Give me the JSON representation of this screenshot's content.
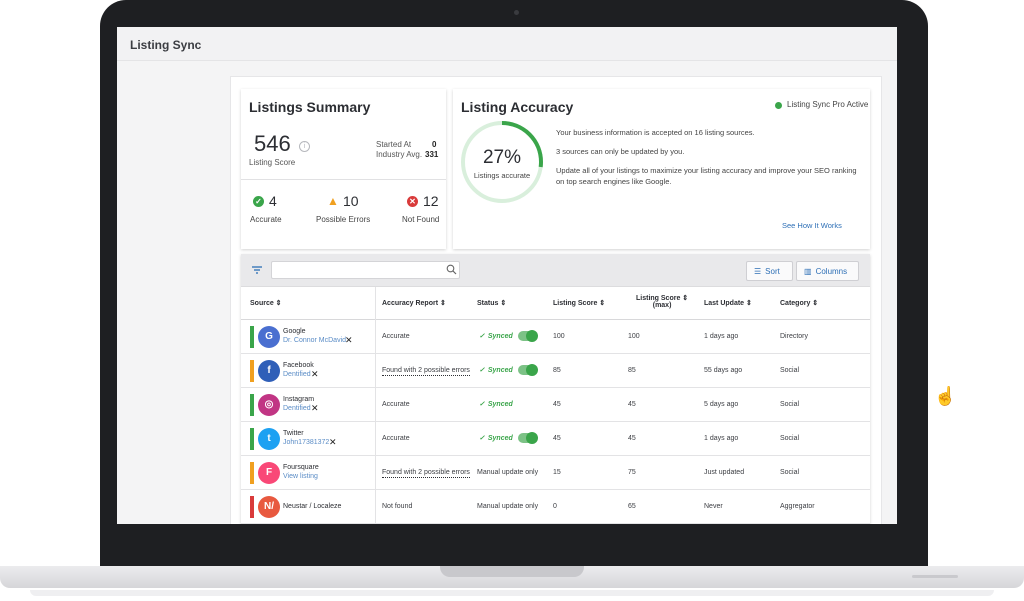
{
  "app": {
    "title": "Listing Sync"
  },
  "summary": {
    "title": "Listings Summary",
    "score": "546",
    "score_label": "Listing Score",
    "started_label": "Started At",
    "started_value": "0",
    "industry_label": "Industry Avg.",
    "industry_value": "331",
    "stats": [
      {
        "value": "4",
        "label": "Accurate",
        "icon": "check-circle-icon",
        "color": "#3aa54a"
      },
      {
        "value": "10",
        "label": "Possible Errors",
        "icon": "warning-triangle-icon",
        "color": "#f0a020"
      },
      {
        "value": "12",
        "label": "Not Found",
        "icon": "x-circle-icon",
        "color": "#d93b3b"
      }
    ]
  },
  "accuracy": {
    "title": "Listing Accuracy",
    "pro_status": "Listing Sync Pro Active",
    "percent": "27%",
    "percent_value": 27,
    "gauge_label": "Listings accurate",
    "line1": "Your business information is accepted on 16 listing sources.",
    "line2": "3 sources can only be updated by you.",
    "line3": "Update all of your listings to maximize your listing accuracy and improve your SEO ranking on top search engines like Google.",
    "see_how": "See How It Works",
    "accent": "#3aa54a"
  },
  "toolbar": {
    "search_placeholder": "",
    "sort_label": "Sort",
    "columns_label": "Columns"
  },
  "table": {
    "headers": {
      "source": "Source",
      "accuracy": "Accuracy Report",
      "status": "Status",
      "score": "Listing Score",
      "score_max_1": "Listing Score",
      "score_max_2": "(max)",
      "last_update": "Last Update",
      "category": "Category"
    },
    "rows": [
      {
        "name": "Google",
        "sub": "Dr. Connor McDavid",
        "accuracy": "Accurate",
        "status": "Synced",
        "score": "100",
        "max": "100",
        "last": "1 days ago",
        "category": "Directory"
      },
      {
        "name": "Facebook",
        "sub": "Dentified",
        "accuracy": "Found with 2 possible errors",
        "status": "Synced",
        "score": "85",
        "max": "85",
        "last": "55 days ago",
        "category": "Social"
      },
      {
        "name": "Instagram",
        "sub": "Dentified",
        "accuracy": "Accurate",
        "status": "Synced",
        "score": "45",
        "max": "45",
        "last": "5 days ago",
        "category": "Social"
      },
      {
        "name": "Twitter",
        "sub": "John17381372",
        "accuracy": "Accurate",
        "status": "Synced",
        "score": "45",
        "max": "45",
        "last": "1 days ago",
        "category": "Social"
      },
      {
        "name": "Foursquare",
        "sub": "View listing",
        "accuracy": "Found with 2 possible errors",
        "status": "Manual update only",
        "score": "15",
        "max": "75",
        "last": "Just updated",
        "category": "Social"
      },
      {
        "name": "Neustar / Localeze",
        "sub": "",
        "accuracy": "Not found",
        "status": "Manual update only",
        "score": "0",
        "max": "65",
        "last": "Never",
        "category": "Aggregator"
      }
    ],
    "logo_glyphs": [
      "G",
      "f",
      "◎",
      "t",
      "F",
      "N/"
    ]
  }
}
